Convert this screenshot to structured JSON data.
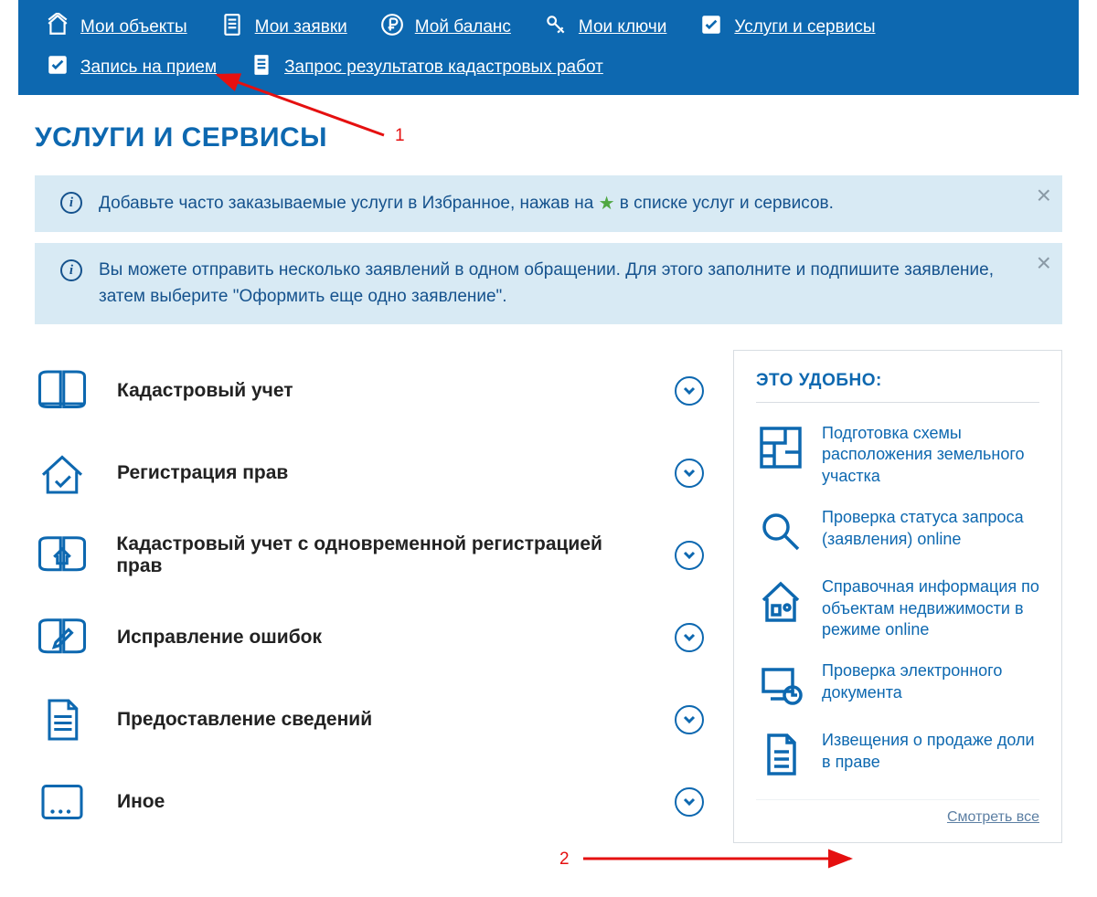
{
  "nav": {
    "items": [
      {
        "label": "Мои объекты",
        "icon": "home"
      },
      {
        "label": "Мои заявки",
        "icon": "doc"
      },
      {
        "label": "Мой баланс",
        "icon": "ruble"
      },
      {
        "label": "Мои ключи",
        "icon": "key"
      },
      {
        "label": "Услуги и сервисы",
        "icon": "check"
      },
      {
        "label": "Запись на прием",
        "icon": "check"
      },
      {
        "label": "Запрос результатов кадастровых работ",
        "icon": "doc2"
      }
    ]
  },
  "page_title": "УСЛУГИ И СЕРВИСЫ",
  "info1_before": "Добавьте часто заказываемые услуги в Избранное, нажав на ",
  "info1_after": " в списке услуг и сервисов.",
  "info2": "Вы можете отправить несколько заявлений в одном обращении. Для этого заполните и подпишите заявление, затем выберите \"Оформить еще одно заявление\".",
  "categories": [
    {
      "title": "Кадастровый учет",
      "icon": "book"
    },
    {
      "title": "Регистрация прав",
      "icon": "house-check"
    },
    {
      "title": "Кадастровый учет с одновременной регистрацией прав",
      "icon": "book-house"
    },
    {
      "title": "Исправление ошибок",
      "icon": "book-pencil"
    },
    {
      "title": "Предоставление сведений",
      "icon": "document"
    },
    {
      "title": "Иное",
      "icon": "other"
    }
  ],
  "sidebar": {
    "title": "ЭТО УДОБНО:",
    "items": [
      {
        "label": "Подготовка схемы расположения земельного участка",
        "icon": "map"
      },
      {
        "label": "Проверка статуса запроса (заявления) online",
        "icon": "search"
      },
      {
        "label": "Справочная информация по объектам недвижимости в режиме online",
        "icon": "house-info"
      },
      {
        "label": "Проверка электронного документа",
        "icon": "device"
      },
      {
        "label": "Извещения о продаже доли в праве",
        "icon": "doc-lines"
      }
    ],
    "see_all": "Смотреть все"
  },
  "annotations": {
    "label1": "1",
    "label2": "2"
  }
}
